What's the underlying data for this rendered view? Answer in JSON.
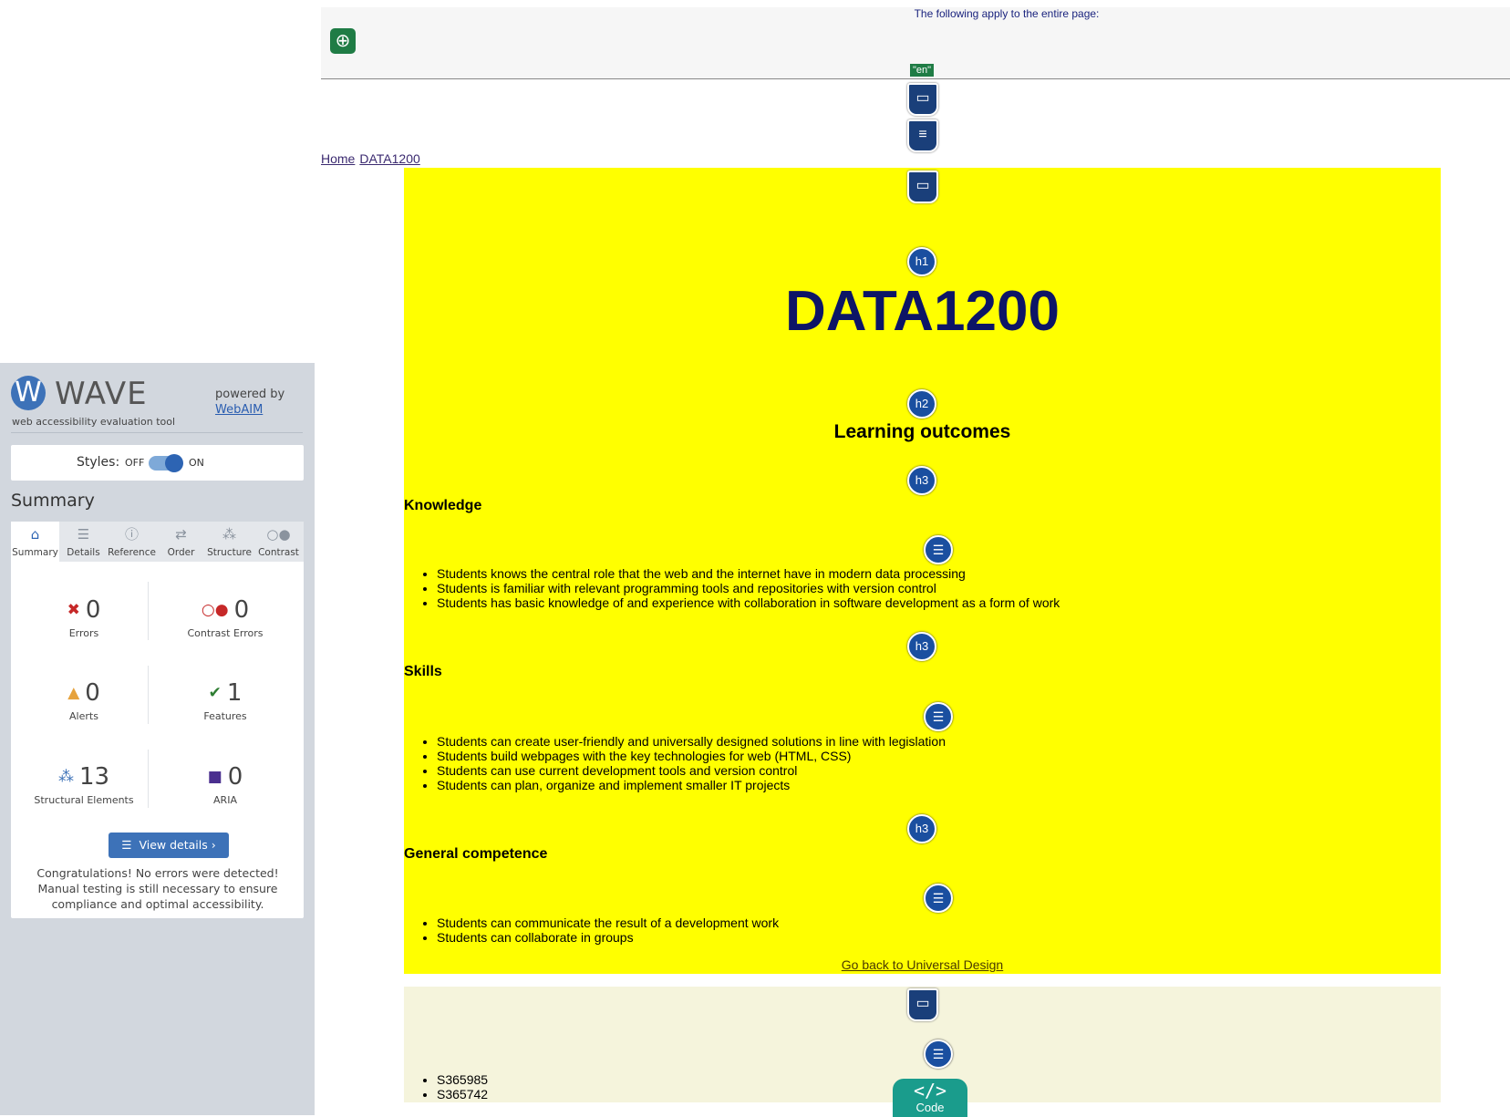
{
  "wave": {
    "logo": "WAVE",
    "tagline": "web accessibility evaluation tool",
    "powered_by": "powered by",
    "powered_link": "WebAIM",
    "styles_label": "Styles:",
    "styles_off": "OFF",
    "styles_on": "ON",
    "styles_enabled": true,
    "summary_heading": "Summary",
    "tabs": [
      {
        "label": "Summary",
        "icon": "home-icon"
      },
      {
        "label": "Details",
        "icon": "list-icon"
      },
      {
        "label": "Reference",
        "icon": "info-icon"
      },
      {
        "label": "Order",
        "icon": "order-icon"
      },
      {
        "label": "Structure",
        "icon": "structure-icon"
      },
      {
        "label": "Contrast",
        "icon": "contrast-icon"
      }
    ],
    "stats": {
      "errors": {
        "count": "0",
        "label": "Errors",
        "color": "#c62828"
      },
      "contrast_errors": {
        "count": "0",
        "label": "Contrast Errors",
        "color": "#c62828"
      },
      "alerts": {
        "count": "0",
        "label": "Alerts",
        "color": "#e6a23c"
      },
      "features": {
        "count": "1",
        "label": "Features",
        "color": "#2e7d32"
      },
      "structural": {
        "count": "13",
        "label": "Structural Elements",
        "color": "#3d72b8"
      },
      "aria": {
        "count": "0",
        "label": "ARIA",
        "color": "#4a2f8f"
      }
    },
    "view_details": "View details ›",
    "congrats": "Congratulations! No errors were detected! Manual testing is still necessary to ensure compliance and optimal accessibility."
  },
  "page": {
    "top_note": "The following apply to the entire page:",
    "lang_badge": "\"en\"",
    "breadcrumbs": [
      "Home",
      "DATA1200"
    ],
    "h1": "DATA1200",
    "h2": "Learning outcomes",
    "sections": [
      {
        "heading": "Knowledge",
        "items": [
          "Students knows the central role that the web and the internet have in modern data processing",
          "Students is familiar with relevant programming tools and repositories with version control",
          "Students has basic knowledge of and experience with collaboration in software development as a form of work"
        ]
      },
      {
        "heading": "Skills",
        "items": [
          "Students can create user-friendly and universally designed solutions in line with legislation",
          "Students build webpages with the key technologies for web (HTML, CSS)",
          "Students can use current development tools and version control",
          "Students can plan, organize and implement smaller IT projects"
        ]
      },
      {
        "heading": "General competence",
        "items": [
          "Students can communicate the result of a development work",
          "Students can collaborate in groups"
        ]
      }
    ],
    "back_link": "Go back to Universal Design",
    "footer_items": [
      "S365985",
      "S365742"
    ],
    "code_button": "Code",
    "code_symbol": "</>",
    "heading_badges": {
      "h1": "h1",
      "h2": "h2",
      "h3": "h3"
    },
    "colors": {
      "main_bg": "#ffff00",
      "footer_bg": "#f5f4dc",
      "title": "#0d1566"
    }
  }
}
